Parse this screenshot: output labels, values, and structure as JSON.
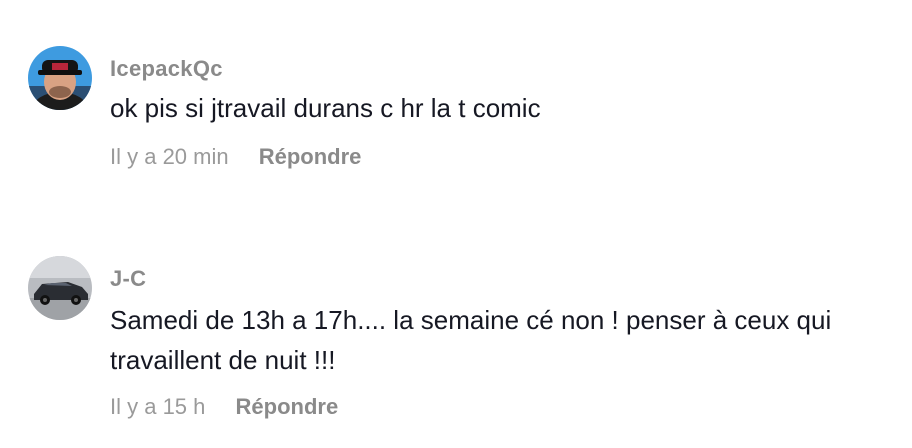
{
  "comments": [
    {
      "username": "IcepackQc",
      "text": "ok pis si jtravail durans c hr la t comic",
      "time": "Il y a 20 min",
      "reply_label": "Répondre",
      "avatar_icon": "user-avatar-cap"
    },
    {
      "username": "J-C",
      "text": "Samedi de 13h a 17h.... la semaine cé non ! penser à ceux qui travaillent de nuit !!!",
      "time": "Il y a 15 h",
      "reply_label": "Répondre",
      "avatar_icon": "car-avatar"
    }
  ],
  "colors": {
    "username": "#8a8a8a",
    "text": "#161823",
    "meta": "#9a9a9a"
  }
}
